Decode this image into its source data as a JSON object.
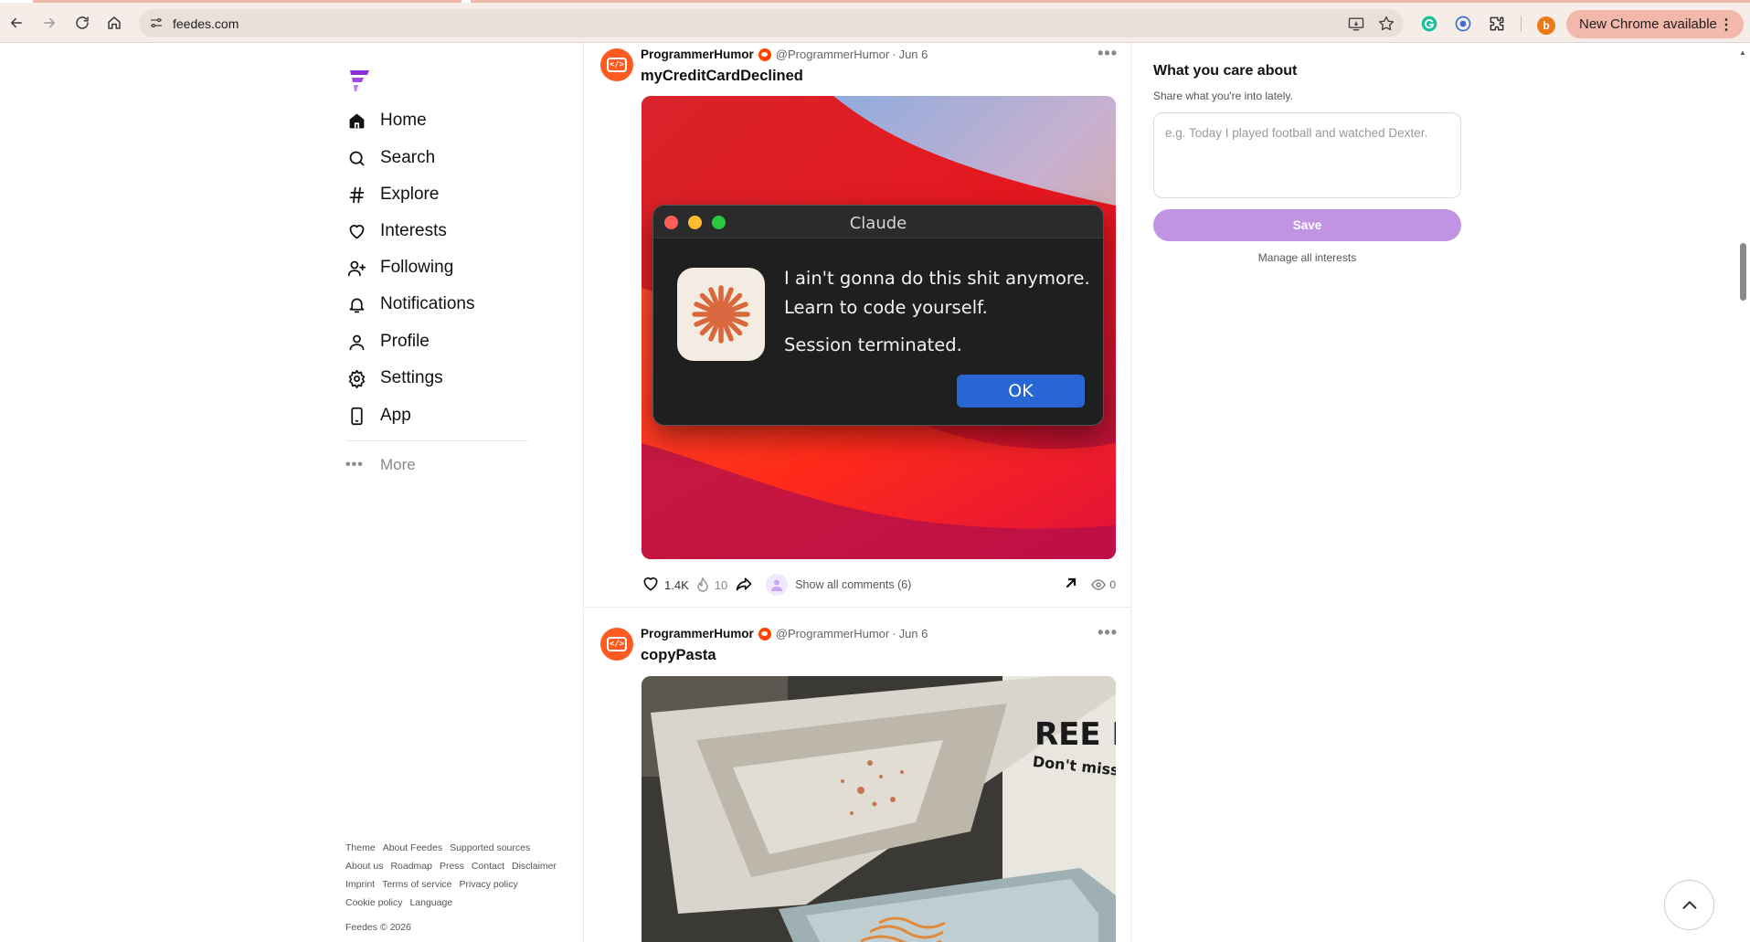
{
  "browser": {
    "url": "feedes.com",
    "update_label": "New Chrome available",
    "profile_initial": "b"
  },
  "nav": {
    "items": [
      {
        "label": "Home",
        "icon": "home-icon",
        "active": true
      },
      {
        "label": "Search",
        "icon": "search-icon"
      },
      {
        "label": "Explore",
        "icon": "hashtag-icon"
      },
      {
        "label": "Interests",
        "icon": "heart-icon"
      },
      {
        "label": "Following",
        "icon": "user-plus-icon"
      },
      {
        "label": "Notifications",
        "icon": "bell-icon"
      },
      {
        "label": "Profile",
        "icon": "user-icon"
      },
      {
        "label": "Settings",
        "icon": "gear-icon"
      },
      {
        "label": "App",
        "icon": "phone-icon"
      }
    ],
    "more_label": "More"
  },
  "footer": {
    "links": [
      "Theme",
      "About Feedes",
      "Supported sources",
      "About us",
      "Roadmap",
      "Press",
      "Contact",
      "Disclaimer",
      "Imprint",
      "Terms of service",
      "Privacy policy",
      "Cookie policy",
      "Language"
    ],
    "copyright": "Feedes © 2026"
  },
  "posts": [
    {
      "author": "ProgrammerHumor",
      "handle": "@ProgrammerHumor",
      "separator": "·",
      "date": "Jun 6",
      "title": "myCreditCardDeclined",
      "likes": "1.4K",
      "hot": "10",
      "comments_label": "Show all comments (6)",
      "views": "0",
      "image": {
        "dialog_title": "Claude",
        "line1": "I ain't gonna do this shit anymore.",
        "line2": "Learn to code yourself.",
        "line3": "Session terminated.",
        "ok_label": "OK"
      }
    },
    {
      "author": "ProgrammerHumor",
      "handle": "@ProgrammerHumor",
      "separator": "·",
      "date": "Jun 6",
      "title": "copyPasta",
      "image": {
        "sign_line1": "REE I",
        "sign_line2": "Don't miss y"
      }
    }
  ],
  "interests_panel": {
    "title": "What you care about",
    "subtitle": "Share what you're into lately.",
    "placeholder": "e.g. Today I played football and watched Dexter.",
    "save_label": "Save",
    "manage_label": "Manage all interests"
  },
  "colors": {
    "accent": "#c193e3",
    "brand": "#8b2fd6",
    "reddit": "#ff4500",
    "dialog_ok": "#2866d6"
  }
}
